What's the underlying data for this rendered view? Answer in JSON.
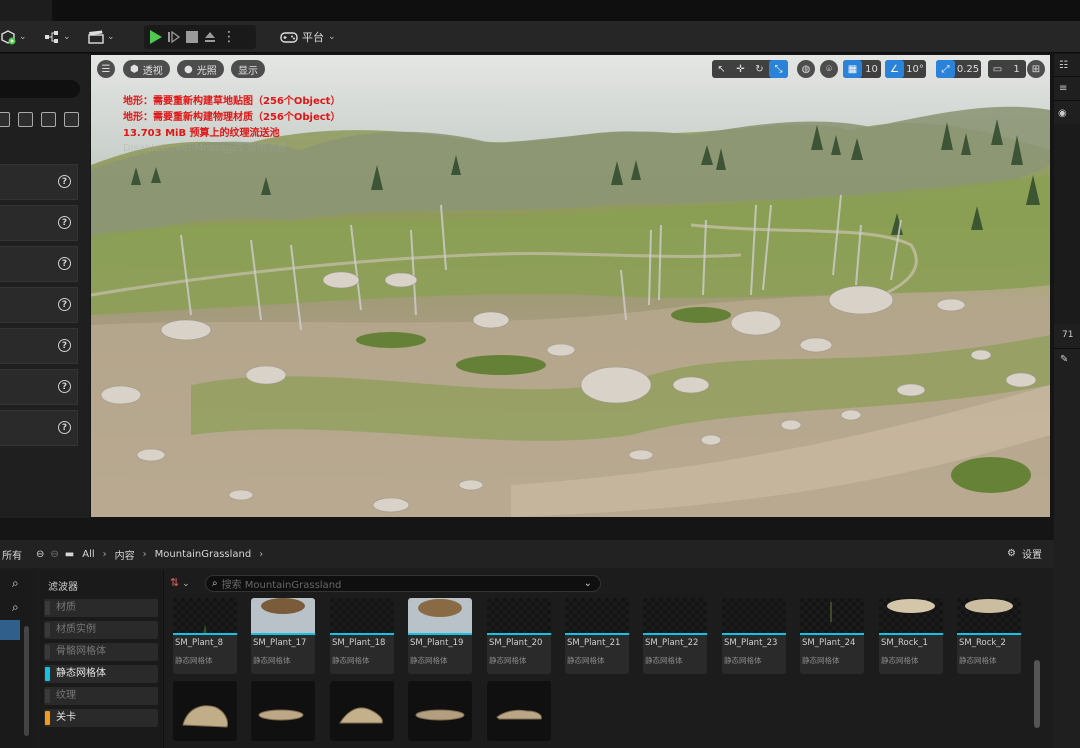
{
  "toolbar": {
    "platform_label": "平台"
  },
  "viewport": {
    "perspective_label": "透视",
    "lighting_label": "光照",
    "show_label": "显示",
    "grid_snap_value": "10",
    "rotation_snap_value": "10°",
    "scale_snap_value": "0.25",
    "camera_speed_value": "1",
    "warnings": [
      "地形：需要重新构建草地贴图（256个Object）",
      "地形：需要重新构建物理材质（256个Object）",
      "13.703 MiB 预算上的纹理流送池"
    ],
    "faint_message": "DisableScreenMessages 禁用消息"
  },
  "right_panel": {
    "number_text": "71"
  },
  "content_browser": {
    "all_label": "所有",
    "breadcrumbs": [
      "All",
      "内容",
      "MountainGrassland"
    ],
    "settings_label": "设置",
    "search_placeholder": "搜索 MountainGrassland",
    "filter_title": "滤波器",
    "filters": [
      {
        "label": "材质",
        "color": "#2a2a2a"
      },
      {
        "label": "材质实例",
        "color": "#2a2a2a"
      },
      {
        "label": "骨骼网格体",
        "color": "#2a2a2a"
      },
      {
        "label": "静态网格体",
        "color": "#12c3e6"
      },
      {
        "label": "纹理",
        "color": "#2a2a2a"
      },
      {
        "label": "关卡",
        "color": "#f29a1b"
      }
    ],
    "assets": [
      {
        "name": "SM_Plant_8",
        "type": "静态网格体"
      },
      {
        "name": "SM_Plant_17",
        "type": "静态网格体"
      },
      {
        "name": "SM_Plant_18",
        "type": "静态网格体"
      },
      {
        "name": "SM_Plant_19",
        "type": "静态网格体"
      },
      {
        "name": "SM_Plant_20",
        "type": "静态网格体"
      },
      {
        "name": "SM_Plant_21",
        "type": "静态网格体"
      },
      {
        "name": "SM_Plant_22",
        "type": "静态网格体"
      },
      {
        "name": "SM_Plant_23",
        "type": "静态网格体"
      },
      {
        "name": "SM_Plant_24",
        "type": "静态网格体"
      },
      {
        "name": "SM_Rock_1",
        "type": "静态网格体"
      },
      {
        "name": "SM_Rock_2",
        "type": "静态网格体"
      }
    ]
  },
  "colors": {
    "accent_blue": "#2a82d9",
    "static_mesh_cyan": "#12c3e6",
    "level_orange": "#f29a1b",
    "play_green": "#4fc84f",
    "warning_red": "#e01515"
  }
}
